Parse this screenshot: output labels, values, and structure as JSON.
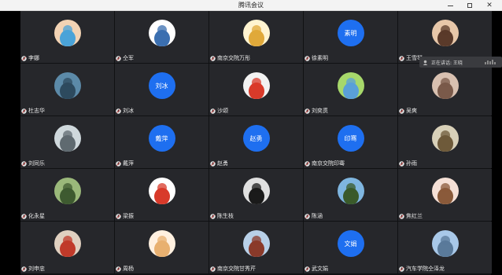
{
  "window": {
    "title": "腾讯会议"
  },
  "speaking": {
    "text": "正在讲话: 王晓"
  },
  "participants": [
    {
      "name": "李娜",
      "avatar_type": "photo",
      "colors": [
        "#f2d3b4",
        "#4aa3d8"
      ]
    },
    {
      "name": "仝军",
      "avatar_type": "photo",
      "colors": [
        "#ffffff",
        "#3b6fb0"
      ]
    },
    {
      "name": "南京交院万彤",
      "avatar_type": "photo",
      "colors": [
        "#fff4d0",
        "#e0a93a"
      ]
    },
    {
      "name": "徐素明",
      "avatar_type": "text",
      "avatar_text": "素明"
    },
    {
      "name": "王雪琴",
      "avatar_type": "photo",
      "colors": [
        "#e7c7a9",
        "#5a3a2a"
      ]
    },
    {
      "name": "杜志华",
      "avatar_type": "photo",
      "colors": [
        "#5c8aa8",
        "#2d4a5e"
      ]
    },
    {
      "name": "刘冰",
      "avatar_type": "text",
      "avatar_text": "刘冰"
    },
    {
      "name": "沙颂",
      "avatar_type": "photo",
      "colors": [
        "#f2f2f2",
        "#d93a2a"
      ]
    },
    {
      "name": "刘奕贯",
      "avatar_type": "photo",
      "colors": [
        "#a7d86b",
        "#5aa0d8"
      ]
    },
    {
      "name": "吴爽",
      "avatar_type": "photo",
      "colors": [
        "#d8c0b0",
        "#7a5a4a"
      ]
    },
    {
      "name": "刘同乐",
      "avatar_type": "photo",
      "colors": [
        "#cfd8dc",
        "#5f6a70"
      ]
    },
    {
      "name": "戴萍",
      "avatar_type": "text",
      "avatar_text": "戴萍"
    },
    {
      "name": "赵勇",
      "avatar_type": "text",
      "avatar_text": "赵勇"
    },
    {
      "name": "南京交院印骞",
      "avatar_type": "text",
      "avatar_text": "印骞"
    },
    {
      "name": "孙雨",
      "avatar_type": "photo",
      "colors": [
        "#d8d0b8",
        "#6e5a3a"
      ]
    },
    {
      "name": "化永星",
      "avatar_type": "photo",
      "colors": [
        "#9ab87a",
        "#3e5a30"
      ]
    },
    {
      "name": "梁振",
      "avatar_type": "photo",
      "colors": [
        "#ffffff",
        "#d83a2a"
      ]
    },
    {
      "name": "陈生枝",
      "avatar_type": "photo",
      "colors": [
        "#e0e0e0",
        "#1a1a1a"
      ]
    },
    {
      "name": "陈涵",
      "avatar_type": "photo",
      "colors": [
        "#7fb6e0",
        "#3a5a2a"
      ]
    },
    {
      "name": "焦红兰",
      "avatar_type": "photo",
      "colors": [
        "#f5e0d6",
        "#8a5a3a"
      ]
    },
    {
      "name": "刘申忠",
      "avatar_type": "photo",
      "colors": [
        "#e0d0c0",
        "#c03a2a"
      ]
    },
    {
      "name": "周杨",
      "avatar_type": "photo",
      "colors": [
        "#fff0e0",
        "#e8b070"
      ]
    },
    {
      "name": "南京交院甘秀芹",
      "avatar_type": "photo",
      "colors": [
        "#b8d0e8",
        "#8a3a2a"
      ]
    },
    {
      "name": "武文娟",
      "avatar_type": "text",
      "avatar_text": "文娟"
    },
    {
      "name": "汽车学院仝泽龙",
      "avatar_type": "photo",
      "colors": [
        "#a8c8e8",
        "#5a7a9a"
      ]
    }
  ]
}
